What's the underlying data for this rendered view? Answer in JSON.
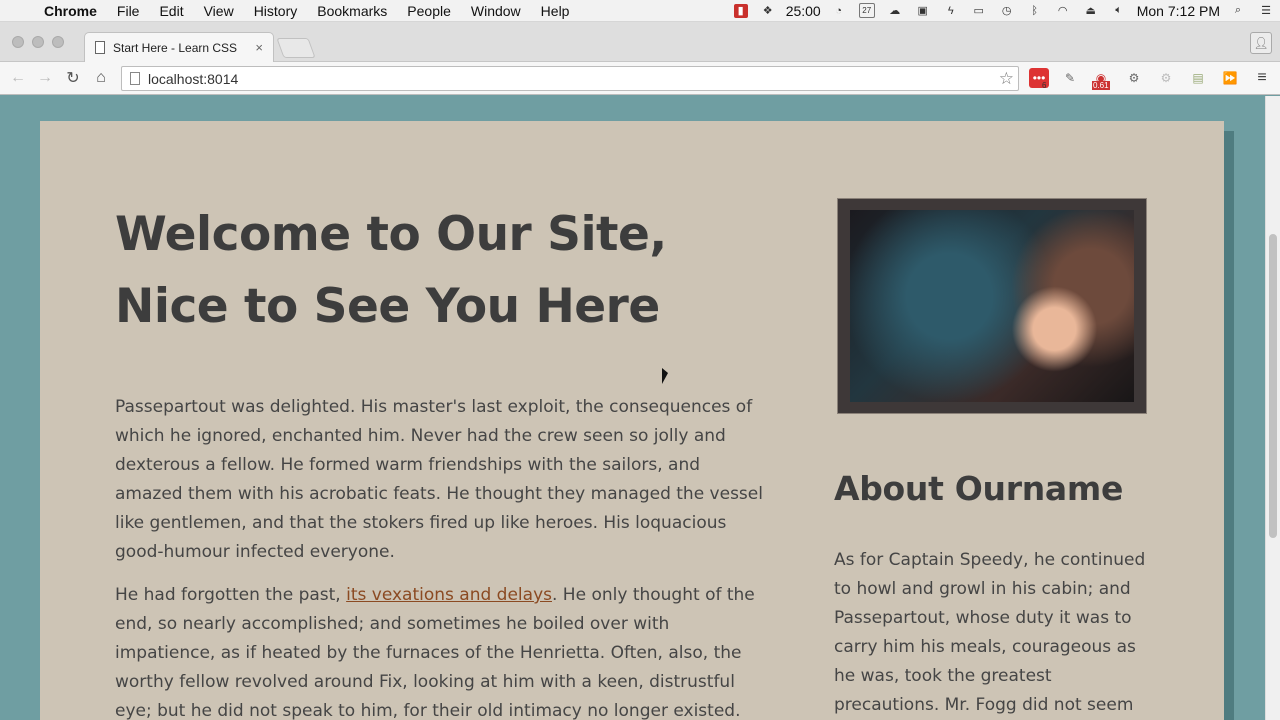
{
  "menubar": {
    "app_name": "Chrome",
    "items": [
      "File",
      "Edit",
      "View",
      "History",
      "Bookmarks",
      "People",
      "Window",
      "Help"
    ],
    "timer": "25:00",
    "calendar_day": "27",
    "clock": "Mon 7:12 PM"
  },
  "browser": {
    "tab_title": "Start Here - Learn CSS",
    "tab_close": "×",
    "url": "localhost:8014",
    "ext_badge_count": "6",
    "ext_badge_load": "0.61"
  },
  "page": {
    "headline_line1": "Welcome to Our Site,",
    "headline_line2": "Nice to See You Here",
    "para1": "Passepartout was delighted. His master's last exploit, the consequences of which he ignored, enchanted him. Never had the crew seen so jolly and dexterous a fellow. He formed warm friendships with the sailors, and amazed them with his acrobatic feats. He thought they managed the vessel like gentlemen, and that the stokers fired up like heroes. His loquacious good-humour infected everyone.",
    "para2_before": "He had forgotten the past, ",
    "para2_link": "its vexations and delays",
    "para2_after": ". He only thought of the end, so nearly accomplished; and sometimes he boiled over with impatience, as if heated by the furnaces of the Henrietta. Often, also, the worthy fellow revolved around Fix, looking at him with a keen, distrustful eye; but he did not speak to him, for their old intimacy no longer existed.",
    "side_heading": "About Ourname",
    "side_para": "As for Captain Speedy, he continued to howl and growl in his cabin; and Passepartout, whose duty it was to carry him his meals, courageous as he was, took the greatest precautions. Mr. Fogg did not seem even to know"
  },
  "colors": {
    "page_bg": "#6f9ea2",
    "card_bg": "#cdc4b5",
    "link": "#8b4a22"
  }
}
